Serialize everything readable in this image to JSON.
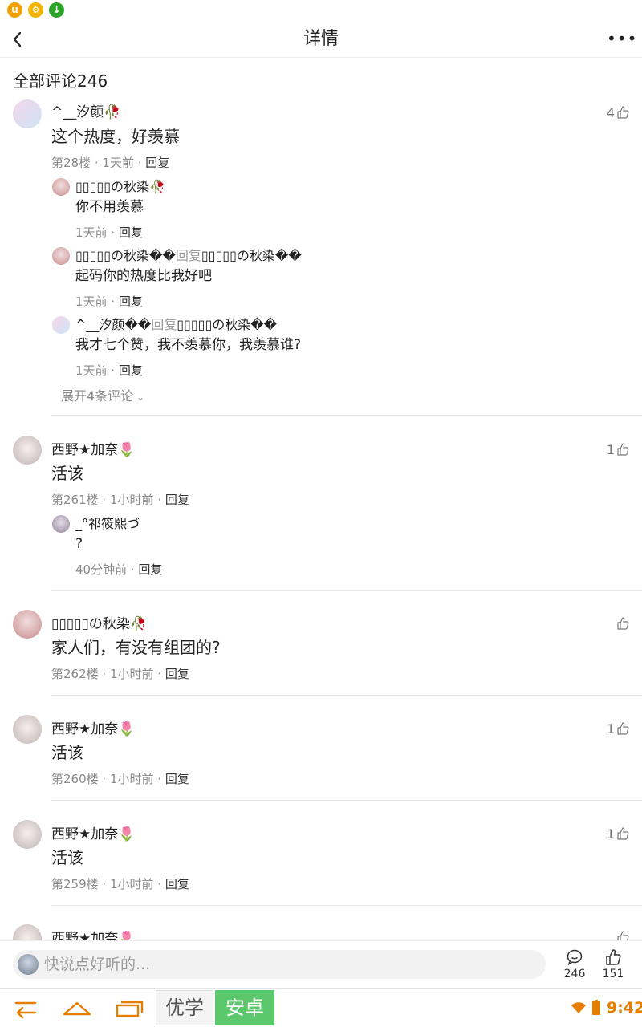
{
  "nav": {
    "title": "详情"
  },
  "comments_header": "全部评论246",
  "c1": {
    "name": "^__汐颜",
    "text": "这个热度，好羡慕",
    "floor": "第28楼",
    "time": "1天前",
    "reply": "回复",
    "likes": "4",
    "replies": [
      {
        "name": "▯▯▯▯▯の秋染",
        "text": "你不用羡慕",
        "time": "1天前",
        "reply": "回复"
      },
      {
        "name": "▯▯▯▯▯の秋染��",
        "reply_word": "回复",
        "target": "▯▯▯▯▯の秋染��",
        "text": "起码你的热度比我好吧",
        "time": "1天前",
        "reply": "回复"
      },
      {
        "name": "^__汐颜��",
        "reply_word": "回复",
        "target": "▯▯▯▯▯の秋染��",
        "text": "我才七个赞，我不羡慕你，我羡慕谁?",
        "time": "1天前",
        "reply": "回复"
      }
    ],
    "expand": "展开4条评论"
  },
  "c2": {
    "name": "西野★加奈",
    "text": "活该",
    "floor": "第261楼",
    "time": "1小时前",
    "reply": "回复",
    "likes": "1",
    "replies": [
      {
        "name": "_°祁筱熙づ",
        "text": "?",
        "time": "40分钟前",
        "reply": "回复"
      }
    ]
  },
  "c3": {
    "name": "▯▯▯▯▯の秋染",
    "text": "家人们，有没有组团的?",
    "floor": "第262楼",
    "time": "1小时前",
    "reply": "回复",
    "likes": ""
  },
  "c4": {
    "name": "西野★加奈",
    "text": "活该",
    "floor": "第260楼",
    "time": "1小时前",
    "reply": "回复",
    "likes": "1"
  },
  "c5": {
    "name": "西野★加奈",
    "text": "活该",
    "floor": "第259楼",
    "time": "1小时前",
    "reply": "回复",
    "likes": "1"
  },
  "c6": {
    "name": "西野★加奈"
  },
  "input": {
    "placeholder": "快说点好听的..."
  },
  "bottom": {
    "comment_count": "246",
    "like_count": "151"
  },
  "sysnav": {
    "tag1": "优学",
    "tag2": "安卓",
    "time": "9:42"
  },
  "colors": {
    "accent_orange": "#e67f00",
    "tag_green": "#5cc86e",
    "status_u": "#f0a000",
    "status_download": "#2aa52a"
  }
}
